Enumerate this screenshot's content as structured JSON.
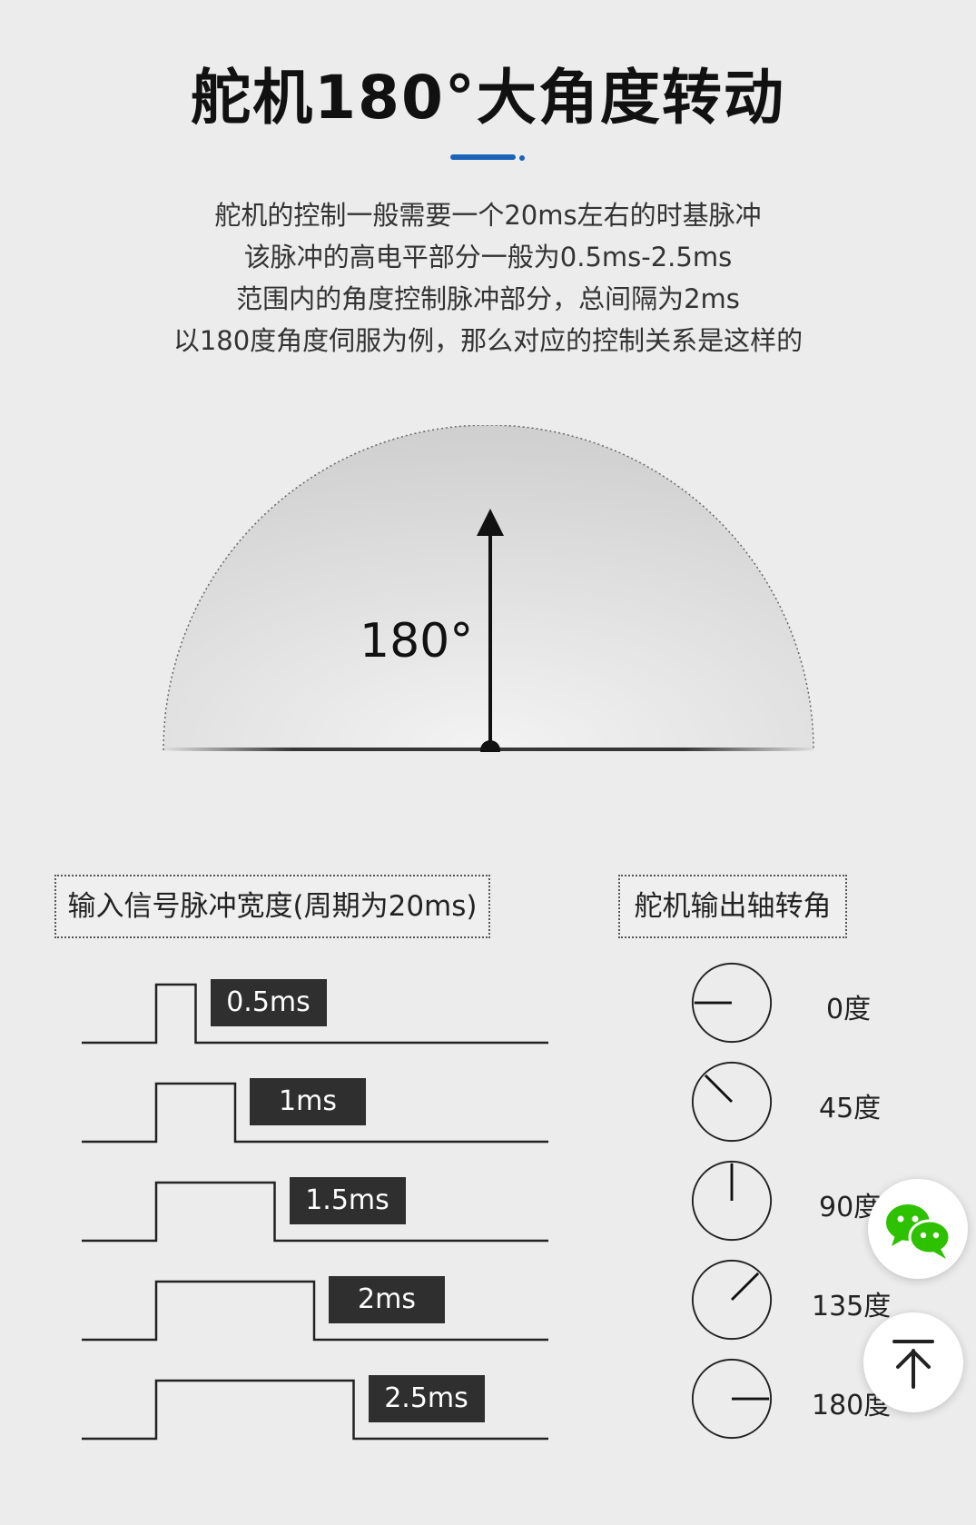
{
  "header": {
    "title": "舵机180°大角度转动"
  },
  "intro": {
    "lines": [
      "舵机的控制一般需要一个20ms左右的时基脉冲",
      "该脉冲的高电平部分一般为0.5ms-2.5ms",
      "范围内的角度控制脉冲部分，总间隔为2ms",
      "以180度角度伺服为例，那么对应的控制关系是这样的"
    ]
  },
  "semicircle": {
    "label": "180°"
  },
  "sections": {
    "input_label": "输入信号脉冲宽度(周期为20ms)",
    "output_label": "舵机输出轴转角"
  },
  "pulses": [
    {
      "width_label": "0.5ms",
      "width_ms": 0.5
    },
    {
      "width_label": "1ms",
      "width_ms": 1
    },
    {
      "width_label": "1.5ms",
      "width_ms": 1.5
    },
    {
      "width_label": "2ms",
      "width_ms": 2
    },
    {
      "width_label": "2.5ms",
      "width_ms": 2.5
    }
  ],
  "angles": [
    {
      "label": "0度",
      "degrees": 0
    },
    {
      "label": "45度",
      "degrees": 45
    },
    {
      "label": "90度",
      "degrees": 90
    },
    {
      "label": "135度",
      "degrees": 135
    },
    {
      "label": "180度",
      "degrees": 180
    }
  ],
  "colors": {
    "accent": "#1a63b8",
    "tag_background": "#2f2f2f",
    "wechat_green": "#2dc100"
  },
  "icons": {
    "wechat": "wechat-icon",
    "back_to_top": "back-to-top-icon"
  }
}
